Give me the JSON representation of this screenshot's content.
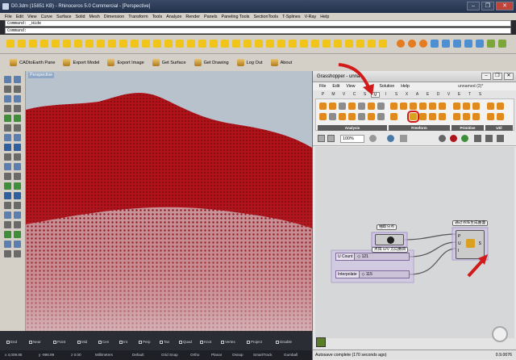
{
  "window": {
    "title": "D0.3dm (15851 KB) - Rhinoceros 5.0 Commercial - [Perspective]",
    "buttons": [
      "–",
      "❐",
      "✕"
    ]
  },
  "menubar": [
    "File",
    "Edit",
    "View",
    "Curve",
    "Surface",
    "Solid",
    "Mesh",
    "Dimension",
    "Transform",
    "Tools",
    "Analyze",
    "Render",
    "Panels",
    "Paneling Tools",
    "SectionTools",
    "T-Splines",
    "V-Ray",
    "Help"
  ],
  "command": {
    "history": "Command: _Hide",
    "prompt": "Command:"
  },
  "cad_toolbar": [
    {
      "label": "CADtoEarth Pane"
    },
    {
      "label": "Export Model"
    },
    {
      "label": "Export Image"
    },
    {
      "label": "Get Surface"
    },
    {
      "label": "Get Drawing"
    },
    {
      "label": "Log Out"
    },
    {
      "label": "About"
    }
  ],
  "viewport": {
    "label": "Perspective",
    "terrain_color": "#b0121a",
    "sky_color": "#b8c2cc"
  },
  "grasshopper": {
    "title": "Grasshopper - unna",
    "document": "unnamed (2)*",
    "menu": [
      "File",
      "Edit",
      "View",
      "",
      ""
    ],
    "menu_items": {
      "solution": "Solution",
      "help": "Help"
    },
    "tabs": [
      "P",
      "M",
      "V",
      "C",
      "S",
      "M",
      "I",
      "S",
      "X",
      "A",
      "E",
      "D",
      "V",
      "E",
      "T",
      "S"
    ],
    "active_tab_index": 5,
    "ribbon_groups": [
      "Analysis",
      "Freeform",
      "Primitive",
      "Util"
    ],
    "zoom": "100%",
    "components": {
      "title_top": "抽取分点",
      "group_label": "点阵 U/V 方向数目",
      "surface_group": "通过点阵生成曲面",
      "surface_inputs": [
        "P",
        "U",
        "I"
      ],
      "surface_output": "S"
    },
    "sliders": [
      {
        "label": "U Count",
        "value": "◇ 121"
      },
      {
        "label": "Interpolate",
        "value": "◇ 115"
      }
    ],
    "status": "Autosave complete (170 seconds ago)",
    "version": "0.9.0076",
    "highlight_color": "#d11a1a"
  },
  "statusbar": {
    "snaps": [
      "End",
      "Near",
      "Point",
      "Mid",
      "Cen",
      "Int",
      "Perp",
      "Tan",
      "Quad",
      "Knot",
      "Vertex",
      "Project",
      "Disable"
    ],
    "coords": [
      "x 4,009.85",
      "y -996.99",
      "z 0.00",
      "Millimeters",
      "Default",
      "Grid Snap",
      "Ortho",
      "Planar",
      "Osnap",
      "SmartTrack",
      "Gumball"
    ]
  }
}
